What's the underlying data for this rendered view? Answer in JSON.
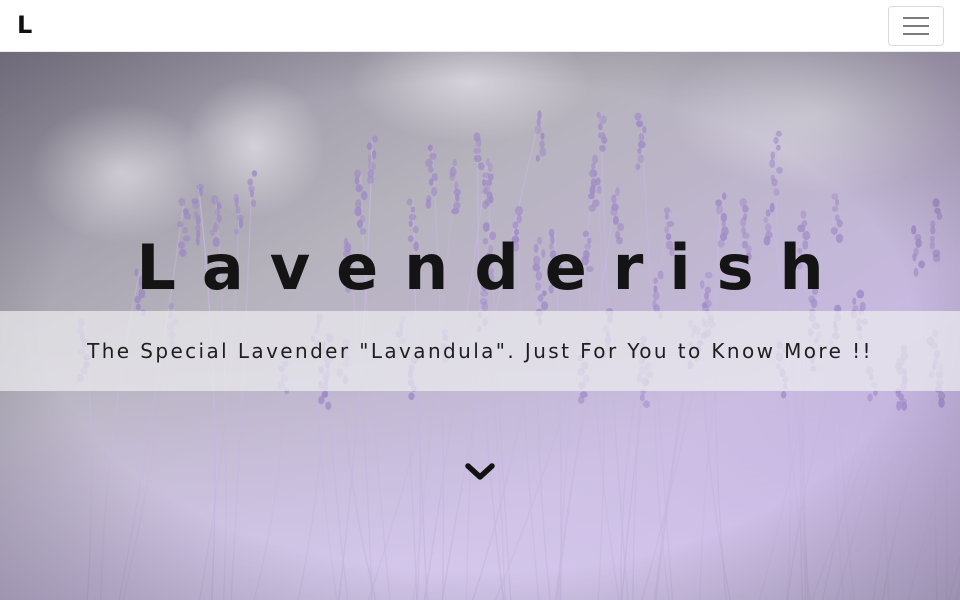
{
  "navbar": {
    "brand": "L",
    "toggler_icon": "hamburger-menu-icon"
  },
  "hero": {
    "title": "Lavenderish",
    "subtitle": "The Special Lavender \"Lavandula\". Just For You to Know More !!",
    "scroll_icon": "chevron-down-icon",
    "background": "lavender field photograph"
  },
  "colors": {
    "navbar_bg": "#ffffff",
    "title_text": "#141414",
    "subtitle_band": "#ebebee",
    "lavender_light": "#cdbde6",
    "lavender_dark": "#8a74b3"
  }
}
